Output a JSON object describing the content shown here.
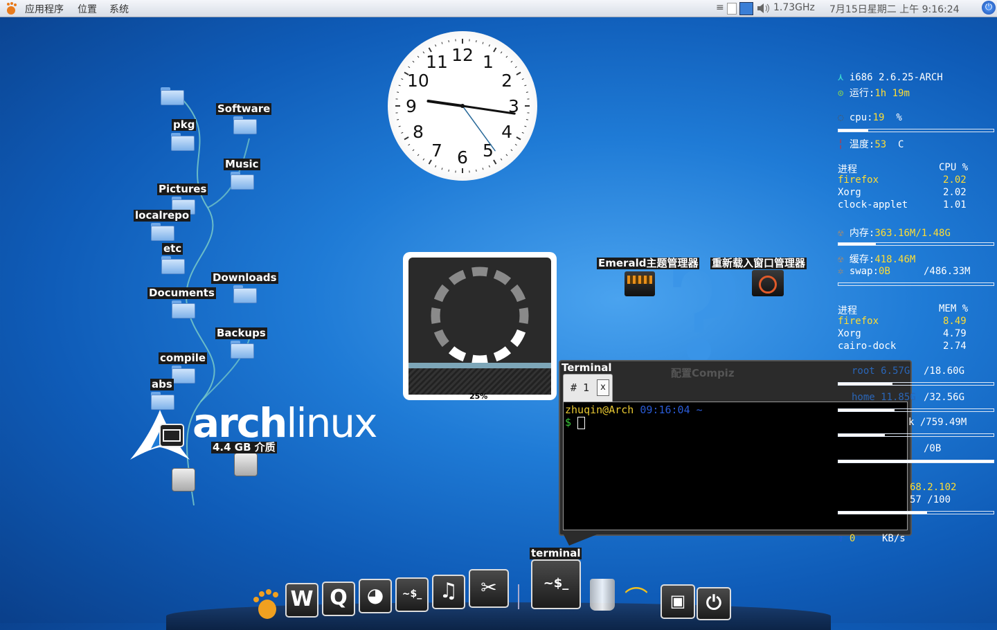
{
  "panel": {
    "menus": [
      "应用程序",
      "位置",
      "系统"
    ],
    "cpu_freq": "1.73GHz",
    "datetime": "7月15日星期二 上午 9:16:24"
  },
  "desktop_icons": [
    {
      "label": "pkg"
    },
    {
      "label": "Software"
    },
    {
      "label": "Music"
    },
    {
      "label": "Pictures"
    },
    {
      "label": "localrepo"
    },
    {
      "label": "etc"
    },
    {
      "label": "Downloads"
    },
    {
      "label": "Documents"
    },
    {
      "label": "Backups"
    },
    {
      "label": "compile"
    },
    {
      "label": "abs"
    },
    {
      "label": "4.4 GB 介质"
    }
  ],
  "clock": {
    "numbers": [
      "12",
      "1",
      "2",
      "3",
      "4",
      "5",
      "6",
      "7",
      "8",
      "9",
      "10",
      "11"
    ],
    "time": "9:16:24"
  },
  "branding": {
    "arch": "arch",
    "linux": "linux"
  },
  "loader": {
    "percent_label": "25%",
    "progress": 0.25
  },
  "launchers": {
    "emerald": "Emerald主题管理器",
    "reload": "重新载入窗口管理器",
    "compiz": "配置Compiz"
  },
  "terminal_popup": {
    "title": "Terminal",
    "tab_label": "# 1",
    "tab_close": "x",
    "prompt_user": "zhuqin@Arch",
    "prompt_time": "09:16:04",
    "prompt_dir": "~",
    "prompt_symbol": "$"
  },
  "sysmon": {
    "kernel": "i686 2.6.25-ARCH",
    "uptime_label": "运行:",
    "uptime_value": "1h 19m",
    "cpu_label": "cpu:",
    "cpu_value": "19",
    "cpu_unit": "%",
    "cpu_fraction": 0.19,
    "temp_label": "温度:",
    "temp_value": "53",
    "temp_unit": "C",
    "cpu_table": {
      "header_proc": "进程",
      "header_val": "CPU %",
      "rows": [
        {
          "name": "firefox",
          "val": "2.02"
        },
        {
          "name": "Xorg",
          "val": "2.02"
        },
        {
          "name": "clock-applet",
          "val": "1.01"
        }
      ]
    },
    "mem_label": "内存:",
    "mem_value": "363.16M/1.48G",
    "mem_fraction": 0.24,
    "cache_label": "缓存:",
    "cache_value": "418.46M",
    "swap_label": "swap:",
    "swap_value": "0B",
    "swap_total": "/486.33M",
    "mem_table": {
      "header_proc": "进程",
      "header_val": "MEM %",
      "rows": [
        {
          "name": "firefox",
          "val": "8.49"
        },
        {
          "name": "Xorg",
          "val": "4.79"
        },
        {
          "name": "cairo-dock",
          "val": "2.74"
        }
      ]
    },
    "root_label": "root 6.57G",
    "root_total": "/18.60G",
    "home_label": "home 11.85G",
    "home_total": "/32.56G",
    "disk3_total": "k /759.49M",
    "disk4_total": "/0B",
    "ip": "68.2.102",
    "wifi": "57 /100",
    "net_up": "0",
    "net_unit": "KB/s"
  },
  "dock": {
    "active_label": "terminal"
  }
}
